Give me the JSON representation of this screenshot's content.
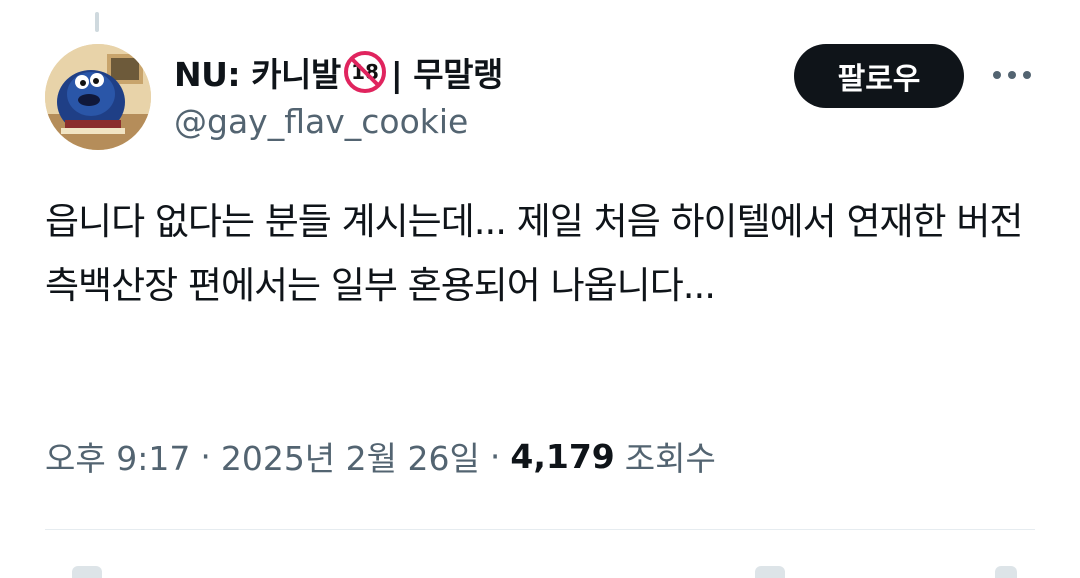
{
  "author": {
    "display_name": "NU: 카니발",
    "age_badge": "18",
    "display_name_suffix": "| 무말랭",
    "handle": "@gay_flav_cookie"
  },
  "follow_label": "팔로우",
  "more_icon": "more-horizontal-icon",
  "tweet": {
    "text": "읍니다 없다는 분들 계시는데... 제일 처음 하이텔에서 연재한 버전 측백산장 편에서는 일부 혼용되어 나옵니다..."
  },
  "meta": {
    "time": "오후 9:17",
    "separator": "·",
    "date": "2025년 2월 26일",
    "views": "4,179",
    "views_label": "조회수"
  },
  "colors": {
    "text": "#0f1419",
    "secondary": "#536471",
    "button_bg": "#0f1419",
    "badge_red": "#e0245e",
    "divider": "#e6ecf0"
  }
}
